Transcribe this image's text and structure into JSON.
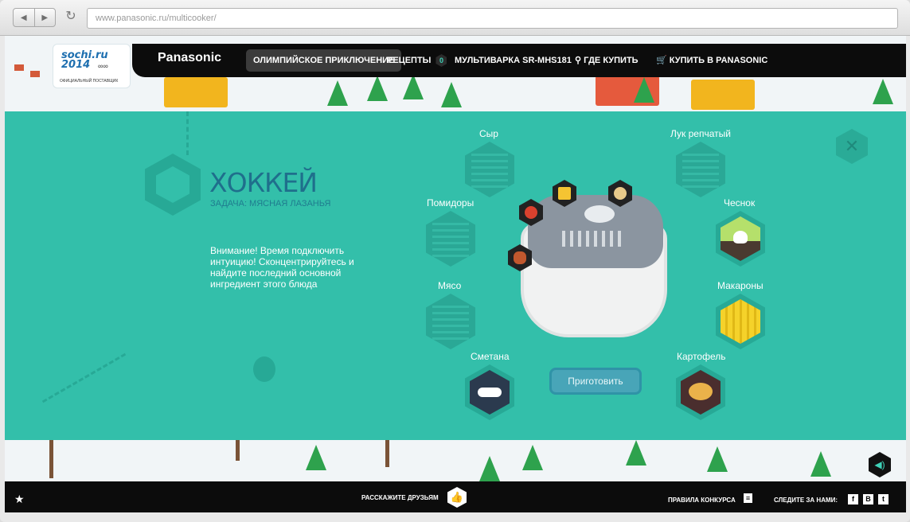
{
  "browser": {
    "url": "www.panasonic.ru/multicooker/",
    "back": "◀",
    "forward": "▶",
    "reload": "↻"
  },
  "sochi": {
    "logo": "sochi.ru 2014",
    "rings": "∞∞",
    "subtitle": "ОФИЦИАЛЬНЫЙ ПОСТАВЩИК"
  },
  "nav": {
    "brand": "Panasonic",
    "items": [
      "ОЛИМПИЙСКОЕ ПРИКЛЮЧЕНИЕ",
      "РЕЦЕПТЫ",
      "МУЛЬТИВАРКА SR-MHS181",
      "ГДЕ КУПИТЬ",
      "КУПИТЬ В PANASONIC"
    ],
    "recipes_count": "0"
  },
  "game": {
    "title": "ХОККЕЙ",
    "task": "ЗАДАЧА: МЯСНАЯ ЛАЗАНЬЯ",
    "description": "Внимание! Время подключить интуицию! Сконцентрируйтесь и найдите последний основной ингредиент этого блюда",
    "cook_button": "Приготовить",
    "ingredients": {
      "cheese": "Сыр",
      "tomatoes": "Помидоры",
      "meat": "Мясо",
      "sour_cream": "Сметана",
      "onion": "Лук репчатый",
      "garlic": "Чеснок",
      "pasta": "Макароны",
      "potato": "Картофель"
    }
  },
  "footer": {
    "share": "РАССКАЖИТЕ ДРУЗЬЯМ",
    "rules": "ПРАВИЛА КОНКУРСА",
    "follow": "СЛЕДИТЕ ЗА НАМИ:",
    "social": [
      "f",
      "В",
      "t"
    ]
  },
  "colors": {
    "panel": "#33bfaa",
    "accent_dark": "#1f6f8c",
    "nav_bg": "#0c0c0c"
  }
}
